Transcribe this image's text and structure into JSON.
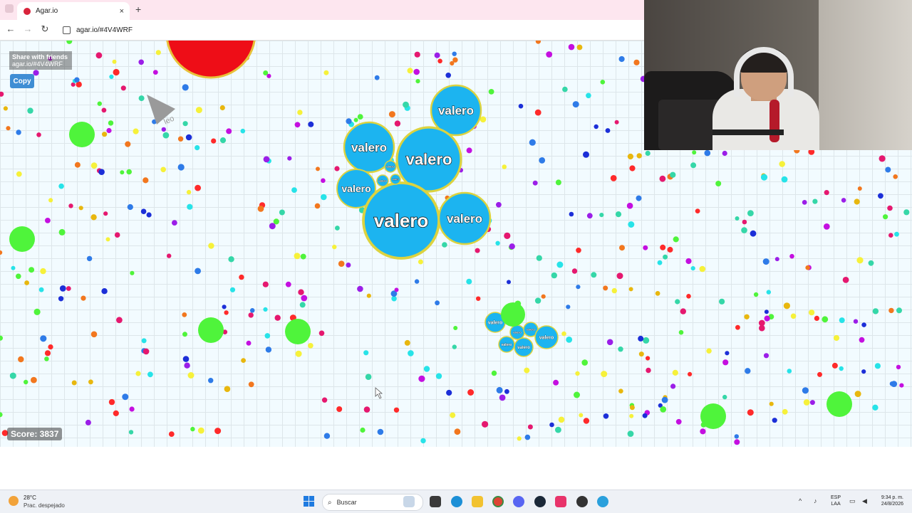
{
  "browser": {
    "tab_title": "Agar.io",
    "tab_close": "×",
    "new_tab": "+",
    "url": "agar.io/#4V4WRF"
  },
  "game": {
    "share_title": "Share with friends",
    "share_url": "agar.io/#4V4WRF",
    "copy_label": "Copy",
    "score_text": "Score: 3837",
    "player_name": "valero",
    "enemy_name": "leo",
    "colors": {
      "player": "#1cb4f0",
      "player_border": "#dcd33f",
      "virus": "#4ff43b",
      "enemy_red": "#ee0d17",
      "background": "#f2fbff"
    }
  },
  "taskbar": {
    "weather_temp": "28°C",
    "weather_desc": "Prac. despejado",
    "search_placeholder": "Buscar",
    "lang_top": "ESP",
    "lang_bottom": "LAA",
    "time": "9:34 p. m.",
    "date": "24/8/2026"
  }
}
